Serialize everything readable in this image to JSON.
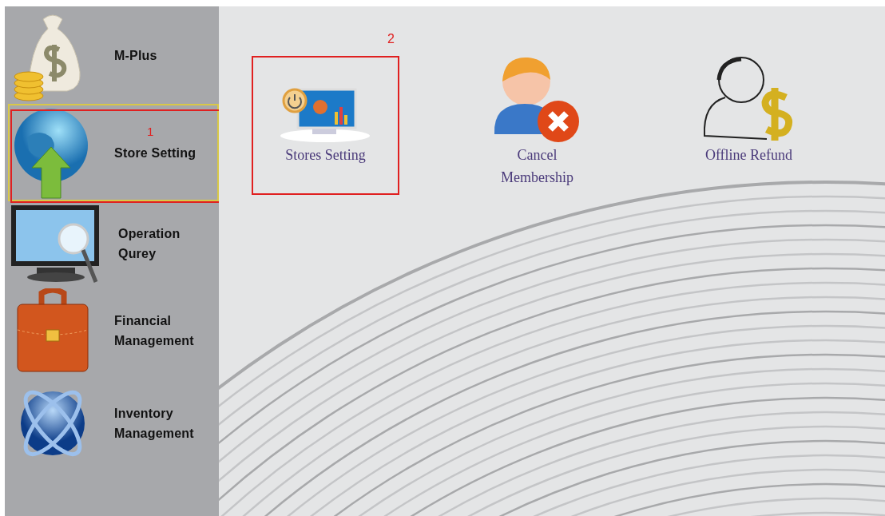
{
  "sidebar": {
    "items": [
      {
        "label": "M-Plus",
        "selected": false
      },
      {
        "label": "Store Setting",
        "selected": true,
        "annotation": "1"
      },
      {
        "label": "Operation Qurey",
        "selected": false
      },
      {
        "label": "Financial Management",
        "selected": false
      },
      {
        "label": "Inventory Management",
        "selected": false
      }
    ]
  },
  "tiles": [
    {
      "label": "Stores Setting",
      "annotation": "2"
    },
    {
      "label": "Cancel Membership"
    },
    {
      "label": "Offline Refund"
    }
  ]
}
